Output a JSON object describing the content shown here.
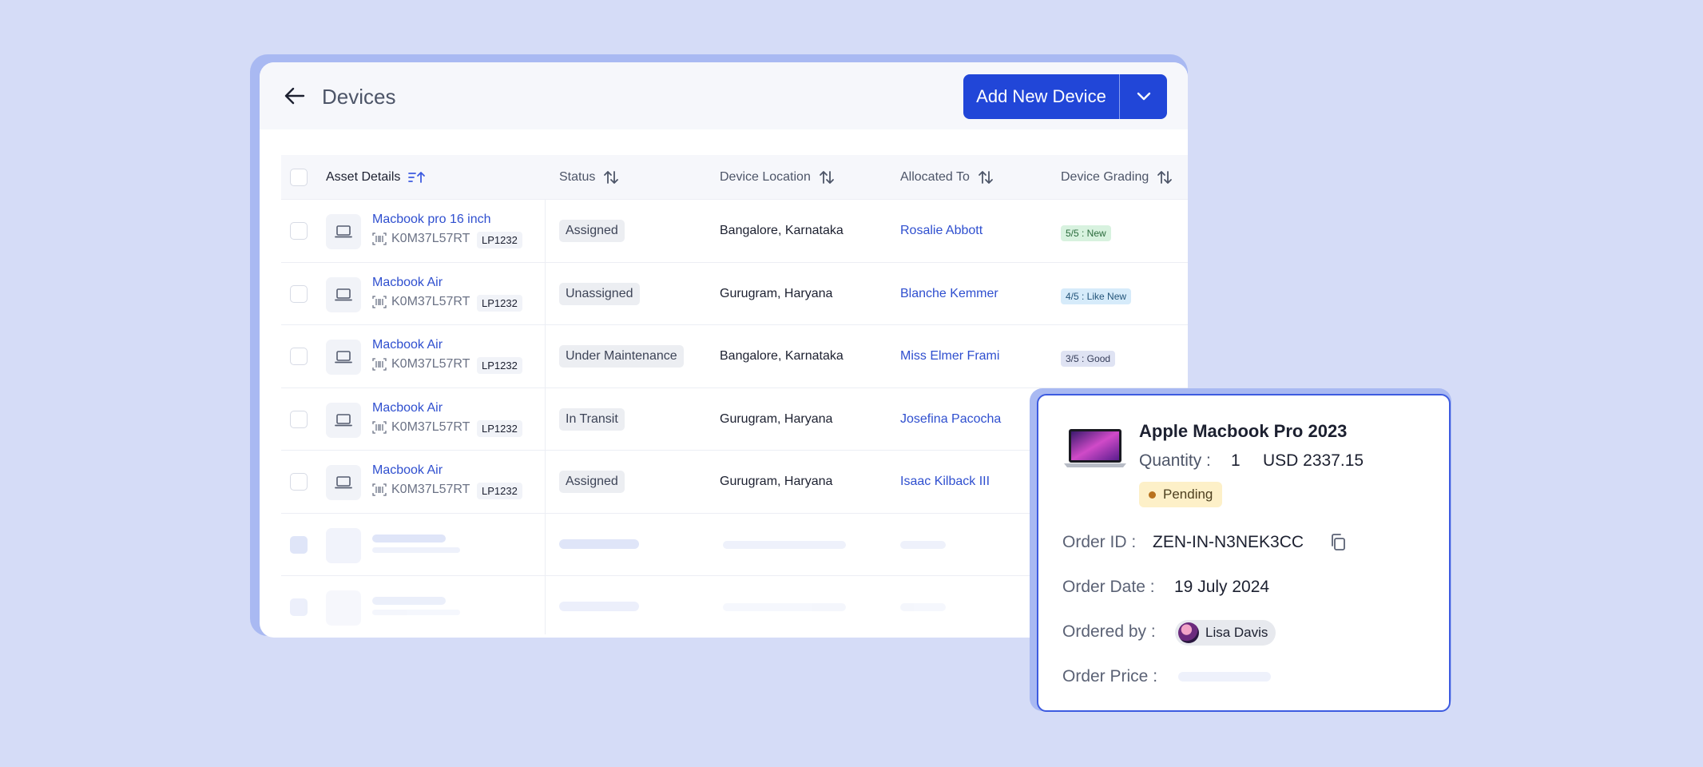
{
  "header": {
    "title": "Devices",
    "add_button_label": "Add New Device"
  },
  "table": {
    "columns": {
      "asset": "Asset Details",
      "status": "Status",
      "location": "Device Location",
      "allocated": "Allocated To",
      "grading": "Device Grading"
    },
    "rows": [
      {
        "name": "Macbook pro 16 inch",
        "serial": "K0M37L57RT",
        "tag": "LP1232",
        "status": "Assigned",
        "location": "Bangalore, Karnataka",
        "allocated": "Rosalie Abbott",
        "grade": "5/5 : New"
      },
      {
        "name": "Macbook Air",
        "serial": "K0M37L57RT",
        "tag": "LP1232",
        "status": "Unassigned",
        "location": "Gurugram, Haryana",
        "allocated": "Blanche Kemmer",
        "grade": "4/5 : Like New"
      },
      {
        "name": "Macbook Air",
        "serial": "K0M37L57RT",
        "tag": "LP1232",
        "status": "Under Maintenance",
        "location": "Bangalore, Karnataka",
        "allocated": "Miss Elmer Frami",
        "grade": "3/5 : Good"
      },
      {
        "name": "Macbook Air",
        "serial": "K0M37L57RT",
        "tag": "LP1232",
        "status": "In Transit",
        "location": "Gurugram, Haryana",
        "allocated": "Josefina Pacocha",
        "grade": ""
      },
      {
        "name": "Macbook Air",
        "serial": "K0M37L57RT",
        "tag": "LP1232",
        "status": "Assigned",
        "location": "Gurugram, Haryana",
        "allocated": "Isaac Kilback III",
        "grade": ""
      }
    ]
  },
  "grade_colors": {
    "new": {
      "bg": "#d8f2df",
      "fg": "#2a6b3c"
    },
    "like_new": {
      "bg": "#d6ebfa",
      "fg": "#24557a"
    },
    "good": {
      "bg": "#dfe3f3",
      "fg": "#343c58"
    }
  },
  "order": {
    "product": "Apple Macbook Pro 2023",
    "quantity_label": "Quantity :",
    "quantity": "1",
    "price": "USD 2337.15",
    "status": "Pending",
    "order_id_label": "Order ID :",
    "order_id": "ZEN-IN-N3NEK3CC",
    "order_date_label": "Order Date :",
    "order_date": "19 July 2024",
    "ordered_by_label": "Ordered by :",
    "ordered_by": "Lisa Davis",
    "order_price_label": "Order Price :"
  },
  "colors": {
    "accent": "#2146d8",
    "link": "#2f4fcf",
    "page_bg": "#d5dcf7"
  }
}
